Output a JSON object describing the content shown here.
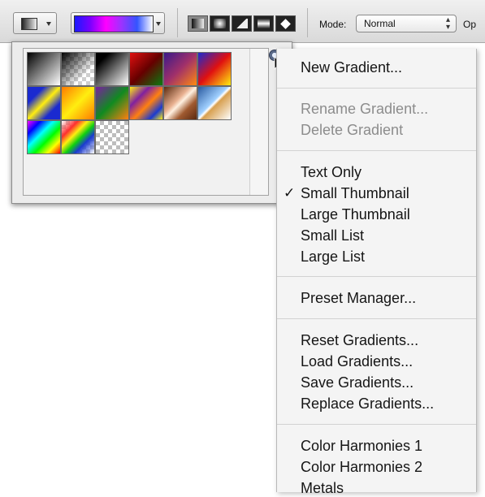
{
  "toolbar": {
    "mode_label": "Mode:",
    "mode_value": "Normal",
    "opacity_label_partial": "Op"
  },
  "gradient_picker": {
    "swatches": [
      {
        "name": "foreground-to-background"
      },
      {
        "name": "foreground-to-transparent"
      },
      {
        "name": "black-white"
      },
      {
        "name": "red-green"
      },
      {
        "name": "violet-orange"
      },
      {
        "name": "blue-red-yellow"
      },
      {
        "name": "blue-yellow-blue"
      },
      {
        "name": "orange-yellow-orange"
      },
      {
        "name": "violet-green-orange"
      },
      {
        "name": "yellow-violet-orange-blue"
      },
      {
        "name": "copper"
      },
      {
        "name": "chrome"
      },
      {
        "name": "spectrum"
      },
      {
        "name": "transparent-rainbow"
      },
      {
        "name": "transparent-stripes"
      }
    ]
  },
  "menu": {
    "new_gradient": "New Gradient...",
    "rename_gradient": "Rename Gradient...",
    "delete_gradient": "Delete Gradient",
    "text_only": "Text Only",
    "small_thumbnail": "Small Thumbnail",
    "large_thumbnail": "Large Thumbnail",
    "small_list": "Small List",
    "large_list": "Large List",
    "preset_manager": "Preset Manager...",
    "reset_gradients": "Reset Gradients...",
    "load_gradients": "Load Gradients...",
    "save_gradients": "Save Gradients...",
    "replace_gradients": "Replace Gradients...",
    "color_harmonies_1": "Color Harmonies 1",
    "color_harmonies_2": "Color Harmonies 2",
    "metals": "Metals",
    "checkmark": "✓"
  }
}
